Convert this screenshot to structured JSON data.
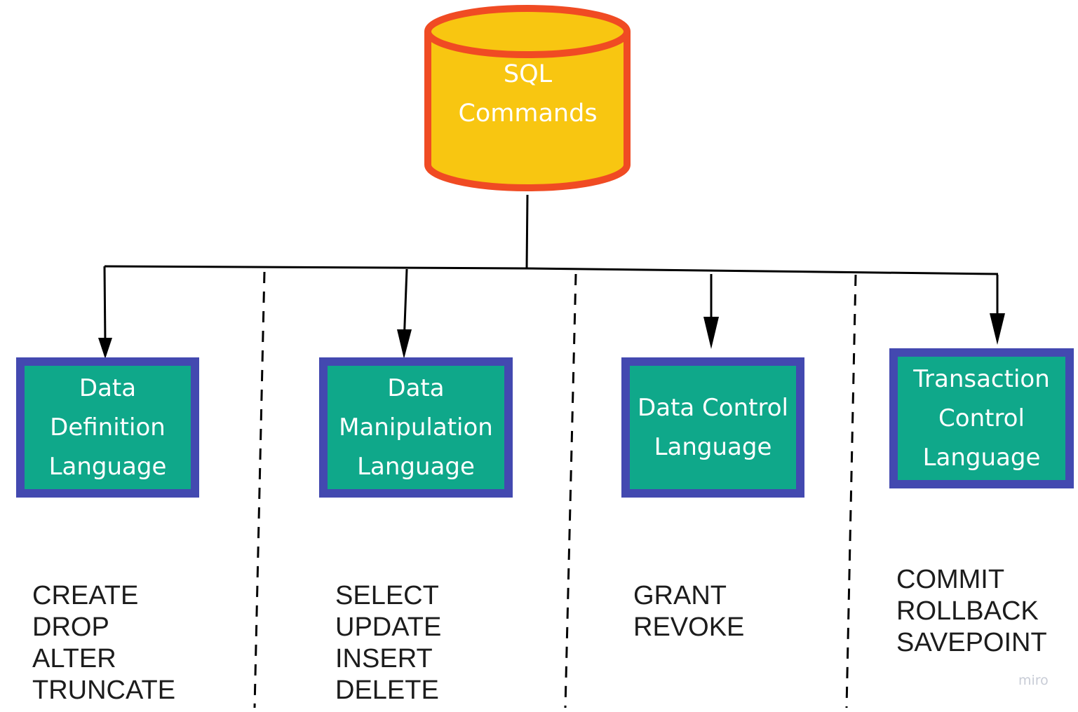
{
  "root": {
    "label_lines": [
      "SQL",
      "Commands"
    ],
    "fill_color": "#f8c611",
    "stroke_color": "#f04b23"
  },
  "categories": [
    {
      "label": "Data\nDefinition\nLanguage",
      "commands": [
        "CREATE",
        "DROP",
        "ALTER",
        "TRUNCATE"
      ]
    },
    {
      "label": "Data\nManipulation\nLanguage",
      "commands": [
        "SELECT",
        "UPDATE",
        "INSERT",
        "DELETE"
      ]
    },
    {
      "label": "Data Control\nLanguage",
      "commands": [
        "GRANT",
        "REVOKE"
      ]
    },
    {
      "label": "Transaction\nControl\nLanguage",
      "commands": [
        "COMMIT",
        "ROLLBACK",
        "SAVEPOINT"
      ]
    }
  ],
  "style": {
    "box_fill": "#0fa88a",
    "box_border": "#4349b0",
    "connector_color": "#000000"
  },
  "watermark": "miro"
}
